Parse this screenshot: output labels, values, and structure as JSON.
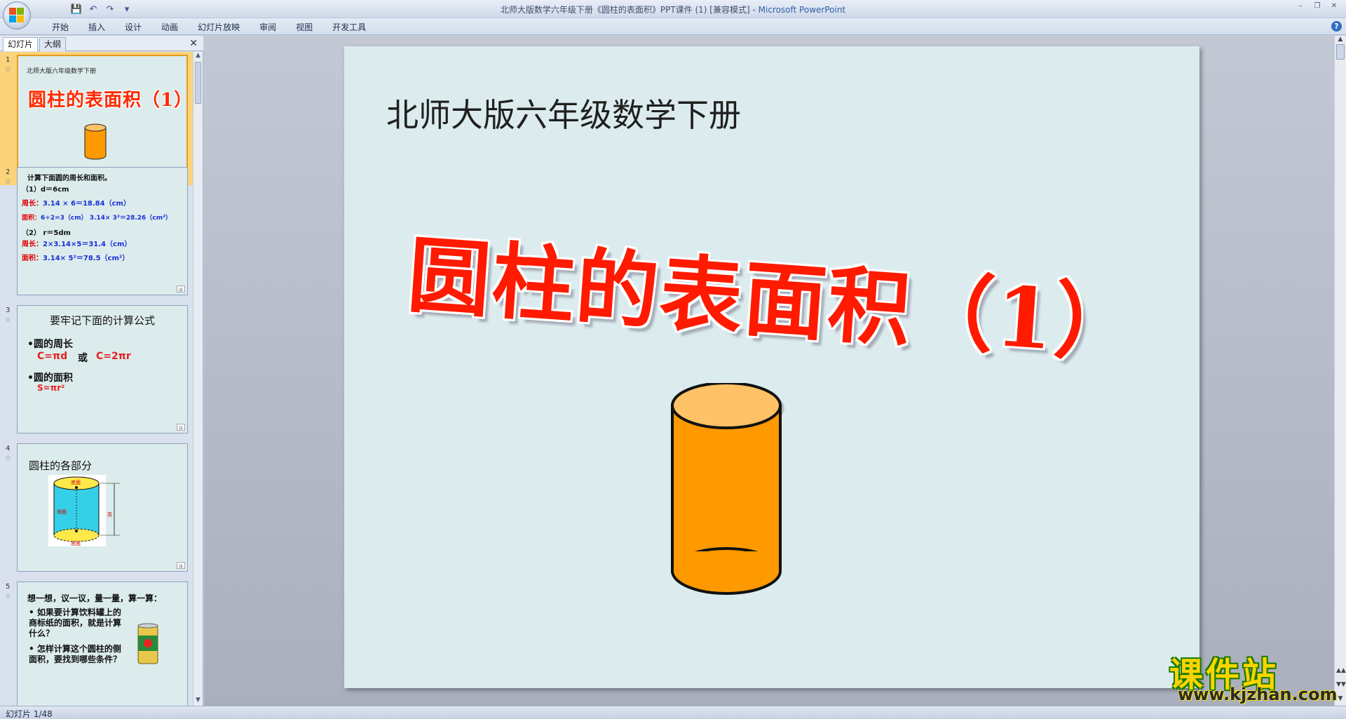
{
  "window": {
    "title": "北师大版数学六年级下册《圆柱的表面积》PPT课件 (1) [兼容模式] - ",
    "app_name": "Microsoft PowerPoint"
  },
  "ribbon": {
    "tabs": [
      "开始",
      "插入",
      "设计",
      "动画",
      "幻灯片放映",
      "审阅",
      "视图",
      "开发工具"
    ]
  },
  "panel": {
    "tabs": [
      "幻灯片",
      "大纲"
    ]
  },
  "thumbnails": [
    {
      "number": "1",
      "subtitle": "北师大版六年级数学下册",
      "title": "圆柱的表面积（1）"
    },
    {
      "number": "2",
      "lines": [
        {
          "text": "计算下面圆的周长和面积。",
          "color": "black"
        },
        {
          "text": "（1）d＝6cm",
          "color": "black"
        },
        {
          "label": "周长：",
          "text": "3.14 × 6＝18.84（cm）"
        },
        {
          "label": "面积：",
          "text": "6÷2=3（cm） 3.14× 3²＝28.26（cm²）"
        },
        {
          "text": "（2） r＝5dm",
          "color": "black"
        },
        {
          "label": "周长：",
          "text": "2×3.14×5＝31.4（cm）"
        },
        {
          "label": "面积：",
          "text": "3.14× 5²＝78.5（cm²）"
        }
      ]
    },
    {
      "number": "3",
      "title": "要牢记下面的计算公式",
      "item1": "•圆的周长",
      "formula1a": "C=πd",
      "or": "或",
      "formula1b": "C=2πr",
      "item2": "•圆的面积",
      "formula2": "S=πr²"
    },
    {
      "number": "4",
      "title": "圆柱的各部分",
      "labels": [
        "底面",
        "侧面",
        "高",
        "底面"
      ]
    },
    {
      "number": "5",
      "title": "想一想，议一议，量一量，算一算：",
      "items": [
        "•  如果要计算饮料罐上的商标纸的面积，就是计算什么？",
        "•  怎样计算这个圆柱的侧面积，要找到哪些条件？"
      ]
    }
  ],
  "slide": {
    "subtitle": "北师大版六年级数学下册",
    "title": "圆柱的表面积（1）",
    "title_color": "#ff1a00",
    "cylinder_color": "#ff9900",
    "cylinder_top_color": "#ffc266",
    "background": "#dcecee"
  },
  "watermark": {
    "title": "课件站",
    "url": "www.kjzhan.com"
  },
  "status": {
    "slide_indicator": "幻灯片 1/48"
  }
}
